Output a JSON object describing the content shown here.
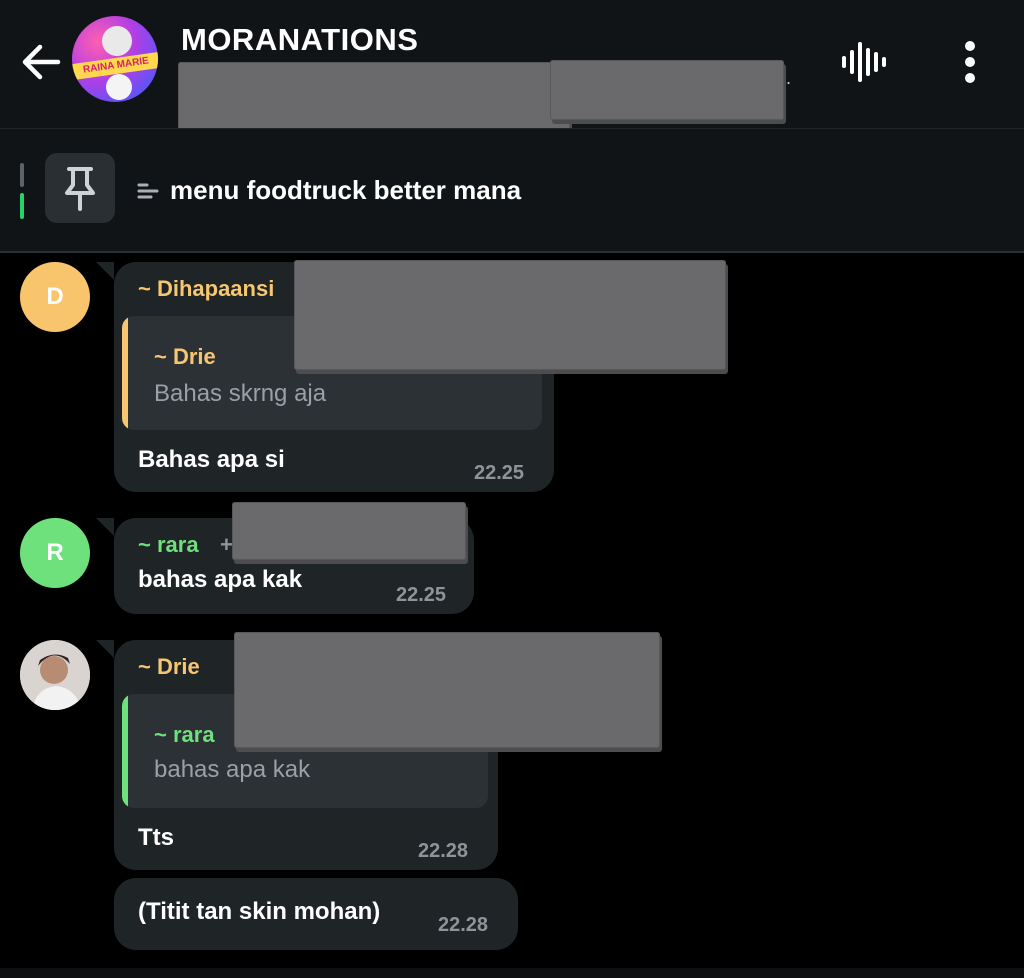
{
  "header": {
    "title": "MORANATIONS",
    "subtitle_fragment": ".",
    "avatar_caption": "RAINA MARIE",
    "back_icon": "arrow-left-icon",
    "voice_icon": "voice-chat-icon",
    "more_icon": "more-vertical-icon"
  },
  "pinned": {
    "icon": "pin-icon",
    "text": "menu foodtruck better mana"
  },
  "colors": {
    "bg": "#000000",
    "header_bg": "#111416",
    "bubble_bg": "#1f2427",
    "sender_orange": "#f6c671",
    "sender_green": "#6ee07c",
    "time_gray": "#8d959b"
  },
  "messages": [
    {
      "avatar_letter": "D",
      "sender": "~ Dihapaansi",
      "quote_sender": "~ Drie",
      "quote_text": "Bahas skrng aja",
      "text": "Bahas apa si",
      "time": "22.25"
    },
    {
      "avatar_letter": "R",
      "sender": "~ rara",
      "sender_suffix": "+",
      "text": "bahas apa kak",
      "time": "22.25"
    },
    {
      "avatar_letter": "",
      "sender": "~ Drie",
      "quote_sender": "~ rara",
      "quote_text": "bahas apa kak",
      "text": "Tts",
      "time": "22.28"
    },
    {
      "text": "(Titit tan skin mohan)",
      "time": "22.28"
    }
  ]
}
